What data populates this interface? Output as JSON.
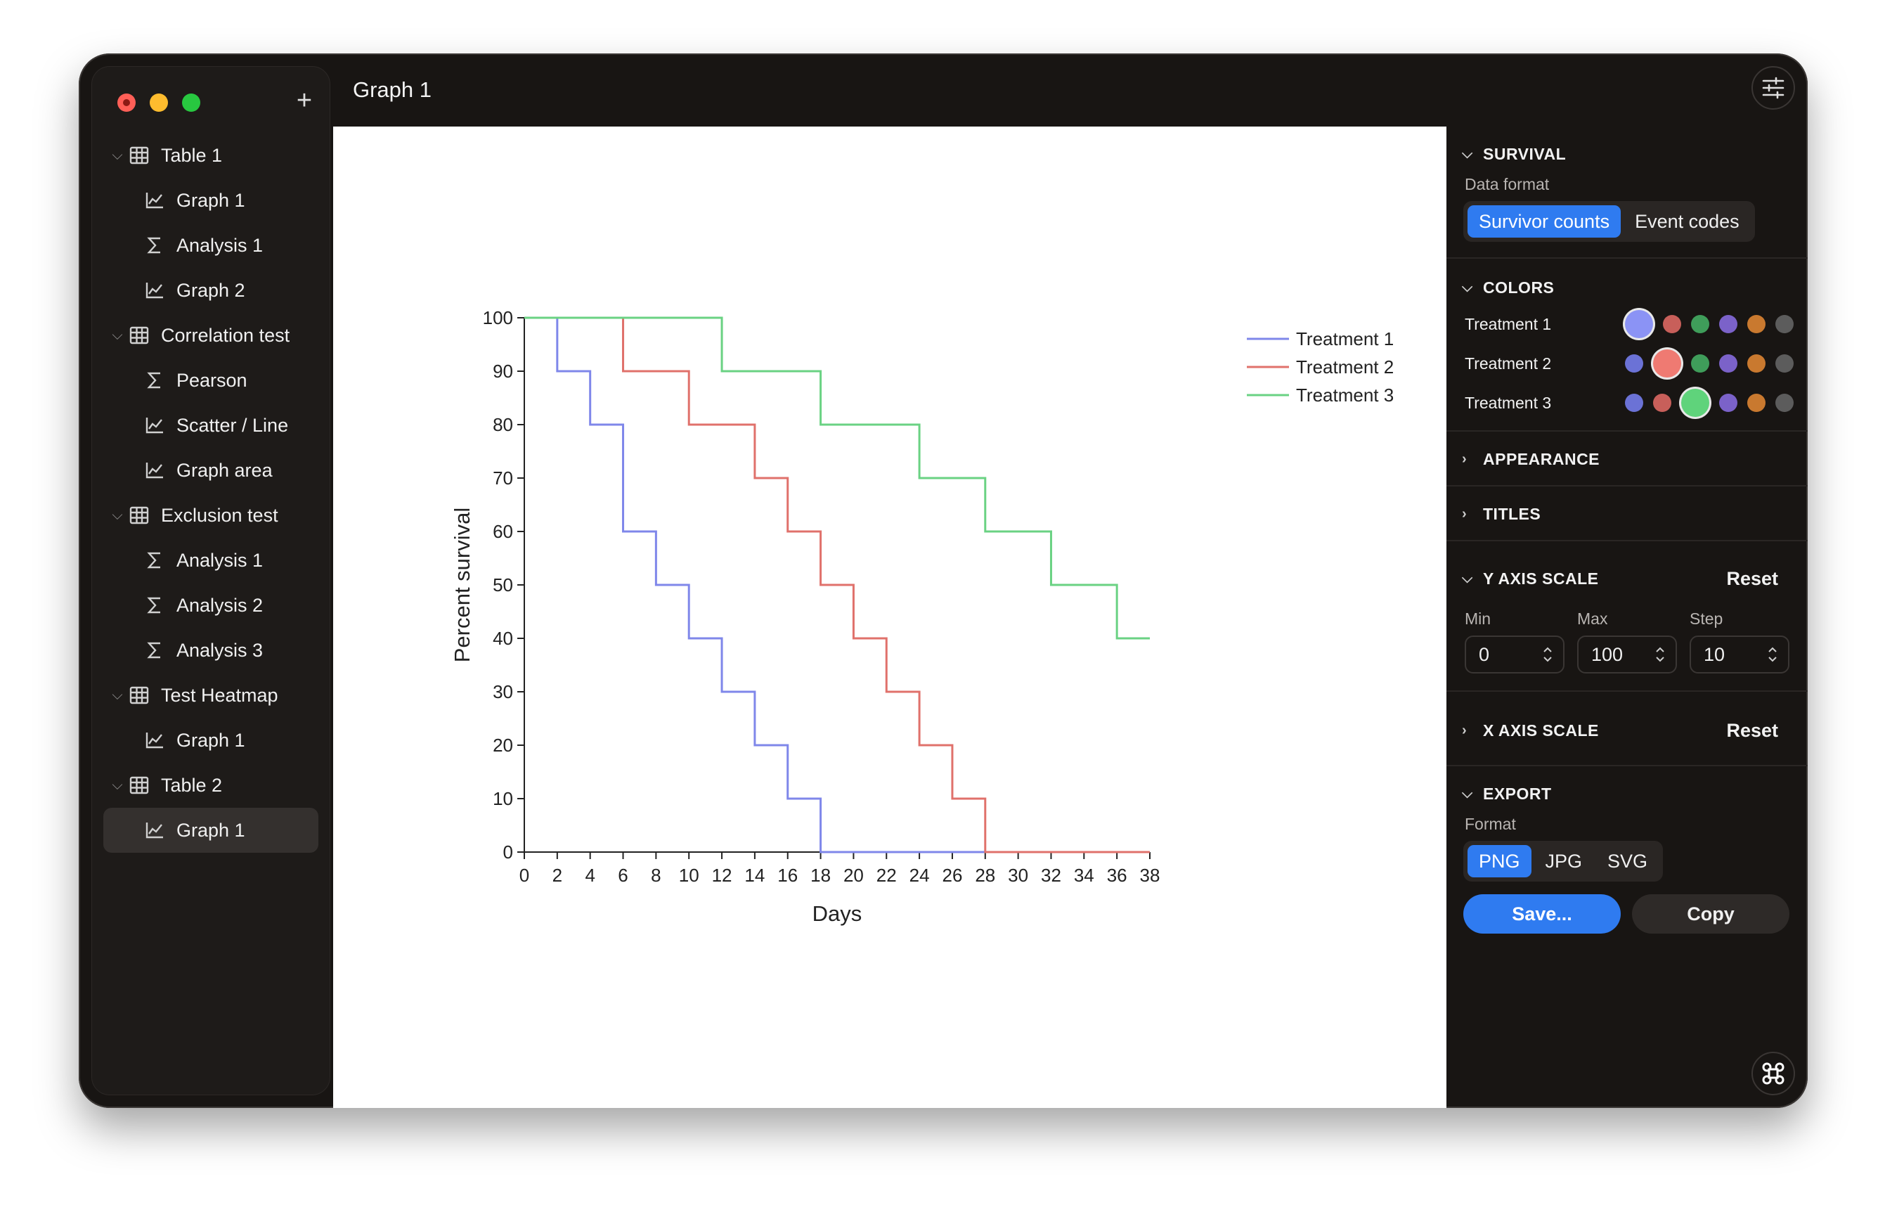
{
  "window": {
    "title": "Graph 1"
  },
  "sidebar": {
    "add_label": "+",
    "items": [
      {
        "label": "Table 1",
        "type": "table",
        "level": 0
      },
      {
        "label": "Graph 1",
        "type": "graph",
        "level": 1
      },
      {
        "label": "Analysis 1",
        "type": "analysis",
        "level": 1
      },
      {
        "label": "Graph 2",
        "type": "graph",
        "level": 1
      },
      {
        "label": "Correlation test",
        "type": "table",
        "level": 0
      },
      {
        "label": "Pearson",
        "type": "analysis",
        "level": 1
      },
      {
        "label": "Scatter / Line",
        "type": "graph",
        "level": 1
      },
      {
        "label": "Graph area",
        "type": "graph",
        "level": 1
      },
      {
        "label": "Exclusion test",
        "type": "table",
        "level": 0
      },
      {
        "label": "Analysis 1",
        "type": "analysis",
        "level": 1
      },
      {
        "label": "Analysis 2",
        "type": "analysis",
        "level": 1
      },
      {
        "label": "Analysis 3",
        "type": "analysis",
        "level": 1
      },
      {
        "label": "Test Heatmap",
        "type": "table",
        "level": 0
      },
      {
        "label": "Graph 1",
        "type": "graph",
        "level": 1
      },
      {
        "label": "Table 2",
        "type": "table",
        "level": 0
      },
      {
        "label": "Graph 1",
        "type": "graph",
        "level": 1,
        "selected": true
      }
    ]
  },
  "panel": {
    "survival": {
      "heading": "SURVIVAL",
      "data_format_label": "Data format",
      "options": [
        "Survivor counts",
        "Event codes"
      ],
      "selected": "Survivor counts"
    },
    "colors": {
      "heading": "COLORS",
      "palette": [
        "#6b72d6",
        "#c85f5a",
        "#3f9d5a",
        "#7b62c9",
        "#c9792f",
        "#5c5c5c"
      ],
      "rows": [
        {
          "label": "Treatment 1",
          "selected_index": 0,
          "selected_color": "#8b93f5"
        },
        {
          "label": "Treatment 2",
          "selected_index": 1,
          "selected_color": "#ef7a72"
        },
        {
          "label": "Treatment 3",
          "selected_index": 2,
          "selected_color": "#5fd37b"
        }
      ]
    },
    "appearance": {
      "heading": "APPEARANCE"
    },
    "titles": {
      "heading": "TITLES"
    },
    "y_axis_scale": {
      "heading": "Y AXIS SCALE",
      "reset": "Reset",
      "min_label": "Min",
      "min": "0",
      "max_label": "Max",
      "max": "100",
      "step_label": "Step",
      "step": "10"
    },
    "x_axis_scale": {
      "heading": "X AXIS SCALE",
      "reset": "Reset"
    },
    "export": {
      "heading": "EXPORT",
      "format_label": "Format",
      "formats": [
        "PNG",
        "JPG",
        "SVG"
      ],
      "selected": "PNG",
      "save": "Save...",
      "copy": "Copy"
    }
  },
  "icons": {
    "settings": "sliders-icon",
    "fab": "command-icon",
    "table": "table-icon",
    "graph": "line-chart-icon",
    "analysis": "sigma-icon"
  },
  "chart_data": {
    "type": "line",
    "step": true,
    "xlabel": "Days",
    "ylabel": "Percent survival",
    "xlim": [
      0,
      38
    ],
    "ylim": [
      0,
      100
    ],
    "xticks": [
      0,
      2,
      4,
      6,
      8,
      10,
      12,
      14,
      16,
      18,
      20,
      22,
      24,
      26,
      28,
      30,
      32,
      34,
      36,
      38
    ],
    "yticks": [
      0,
      10,
      20,
      30,
      40,
      50,
      60,
      70,
      80,
      90,
      100
    ],
    "legend": "top-right",
    "series": [
      {
        "name": "Treatment 1",
        "color": "#7f87ea",
        "x": [
          0,
          2,
          4,
          6,
          8,
          10,
          12,
          14,
          16,
          18,
          38
        ],
        "y": [
          100,
          90,
          80,
          60,
          50,
          40,
          30,
          20,
          10,
          0,
          0
        ]
      },
      {
        "name": "Treatment 2",
        "color": "#e0716b",
        "x": [
          0,
          6,
          10,
          14,
          16,
          18,
          20,
          22,
          24,
          26,
          28,
          38
        ],
        "y": [
          100,
          90,
          80,
          70,
          60,
          50,
          40,
          30,
          20,
          10,
          0,
          0
        ]
      },
      {
        "name": "Treatment 3",
        "color": "#6ad283",
        "x": [
          0,
          12,
          18,
          24,
          28,
          32,
          36,
          38
        ],
        "y": [
          100,
          90,
          80,
          70,
          60,
          50,
          40,
          40
        ]
      }
    ]
  }
}
